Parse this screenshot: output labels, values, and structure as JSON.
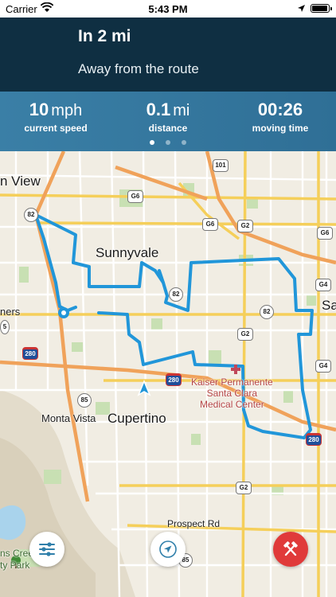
{
  "status_bar": {
    "carrier": "Carrier",
    "time": "5:43 PM"
  },
  "banner": {
    "distance": "In 2 mi",
    "instruction": "Away from the route"
  },
  "stats": [
    {
      "value": "10",
      "unit": "mph",
      "label": "current speed"
    },
    {
      "value": "0.1",
      "unit": "mi",
      "label": "distance"
    },
    {
      "value": "00:26",
      "unit": "",
      "label": "moving time"
    }
  ],
  "page_indicator": {
    "count": 3,
    "active": 0
  },
  "map": {
    "labels": {
      "mountain_view": "n View",
      "sunnyvale": "Sunnyvale",
      "cupertino": "Cupertino",
      "monta_vista": "Monta Vista",
      "kaiser": "Kaiser Permanente\nSanta Clara\nMedical Center",
      "prospect": "Prospect Rd",
      "sa": "Sa",
      "ners": "ners",
      "park": "ns Cree\nty Park"
    },
    "shields": {
      "r101": "101",
      "g6a": "G6",
      "g6b": "G6",
      "g6c": "G6",
      "g2a": "G2",
      "g2b": "G2",
      "g2c": "G2",
      "g4a": "G4",
      "g4b": "G4",
      "r82a": "82",
      "r82b": "82",
      "r82c": "82",
      "r85a": "85",
      "r85b": "85",
      "i280a": "280",
      "i280b": "280",
      "i280c": "280",
      "r5": "5"
    },
    "route_color": "#2196d9"
  },
  "colors": {
    "banner_bg": "#0f2f42",
    "stats_bg": "#3a7fa6",
    "route": "#2196d9",
    "end_button": "#e03a3a"
  },
  "icons": {
    "settings": "sliders-icon",
    "locate": "compass-arrow-icon",
    "end": "crossed-hammers-icon"
  }
}
